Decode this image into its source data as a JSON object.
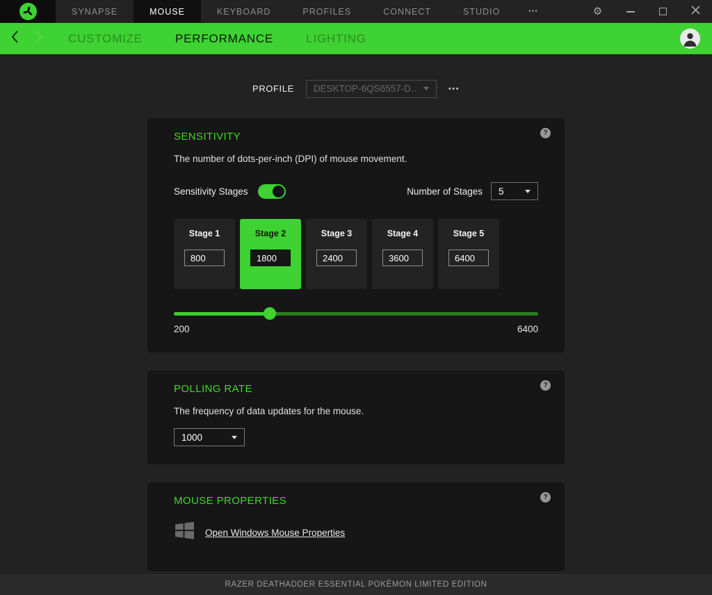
{
  "colors": {
    "accent": "#44d62c",
    "panel_bg": "#161616",
    "page_bg": "#222222",
    "footer_bg": "#2b2b2b"
  },
  "icons": {
    "gear": "⚙",
    "help": "?",
    "ellipsis": "•••"
  },
  "titlebar": {
    "tabs": [
      {
        "label": "SYNAPSE",
        "active": false
      },
      {
        "label": "MOUSE",
        "active": true
      },
      {
        "label": "KEYBOARD",
        "active": false
      },
      {
        "label": "PROFILES",
        "active": false
      },
      {
        "label": "CONNECT",
        "active": false
      },
      {
        "label": "STUDIO",
        "active": false
      }
    ]
  },
  "subnav": {
    "tabs": [
      {
        "label": "CUSTOMIZE",
        "active": false
      },
      {
        "label": "PERFORMANCE",
        "active": true
      },
      {
        "label": "LIGHTING",
        "active": false
      }
    ]
  },
  "profile": {
    "label": "PROFILE",
    "value": "DESKTOP-6QS6557-D…"
  },
  "sensitivity": {
    "title": "SENSITIVITY",
    "description": "The number of dots-per-inch (DPI) of mouse movement.",
    "stages_toggle_label": "Sensitivity Stages",
    "stages_toggle_state": "on",
    "number_of_stages_label": "Number of Stages",
    "number_of_stages_value": "5",
    "stages": [
      {
        "label": "Stage 1",
        "value": "800",
        "active": false
      },
      {
        "label": "Stage 2",
        "value": "1800",
        "active": true
      },
      {
        "label": "Stage 3",
        "value": "2400",
        "active": false
      },
      {
        "label": "Stage 4",
        "value": "3600",
        "active": false
      },
      {
        "label": "Stage 5",
        "value": "6400",
        "active": false
      }
    ],
    "slider": {
      "min_label": "200",
      "max_label": "6400",
      "current_value": 1800,
      "position_pct": 26.4
    }
  },
  "polling_rate": {
    "title": "POLLING RATE",
    "description": "The frequency of data updates for the mouse.",
    "value": "1000"
  },
  "mouse_properties": {
    "title": "MOUSE PROPERTIES",
    "link_label": "Open Windows Mouse Properties"
  },
  "footer": {
    "device_name": "RAZER DEATHADDER ESSENTIAL POKÉMON LIMITED EDITION"
  }
}
